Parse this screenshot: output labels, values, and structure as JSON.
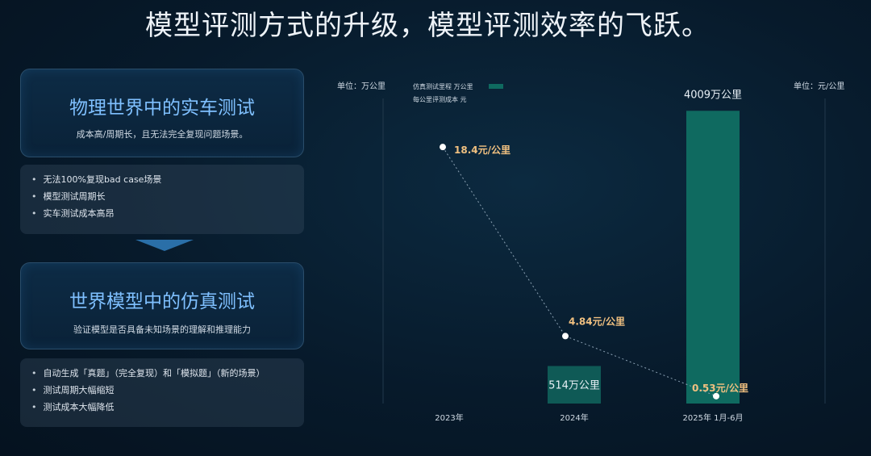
{
  "headline": "模型评测方式的升级，模型评测效率的飞跃。",
  "left": {
    "card1": {
      "title": "物理世界中的实车测试",
      "subtitle": "成本高/周期长，且无法完全复现问题场景。"
    },
    "list1": [
      "无法100%复现bad case场景",
      "模型测试周期长",
      "实车测试成本高昂"
    ],
    "card2": {
      "title": "世界模型中的仿真测试",
      "subtitle": "验证模型是否具备未知场景的理解和推理能力"
    },
    "list2": [
      "自动生成「真题」（完全复现）和「模拟题」（新的场景）",
      "测试周期大幅缩短",
      "测试成本大幅降低"
    ]
  },
  "colors": {
    "bar": "#0f5a56",
    "bar_tall": "#0f6a60",
    "line_label": "#f0c080",
    "accent": "#7fc0ff"
  },
  "chart_data": {
    "type": "bar",
    "categories": [
      "2023年",
      "2024年",
      "2025年 1月-6月"
    ],
    "series": [
      {
        "name": "仿真测试里程 万公里",
        "kind": "bar",
        "unit": "万公里",
        "values": [
          0,
          514,
          4009
        ],
        "labels": [
          "",
          "514万公里",
          "4009万公里"
        ]
      },
      {
        "name": "每公里评测成本 元",
        "kind": "line",
        "unit": "元/公里",
        "values": [
          18.4,
          4.84,
          0.53
        ],
        "labels": [
          "18.4元/公里",
          "4.84元/公里",
          "0.53元/公里"
        ]
      }
    ],
    "y_left_label": "单位：万公里",
    "y_right_label": "单位：元/公里",
    "y_left_range": [
      0,
      4200
    ],
    "y_right_range": [
      0,
      22
    ],
    "grid": false,
    "legend_position": "top-left"
  }
}
